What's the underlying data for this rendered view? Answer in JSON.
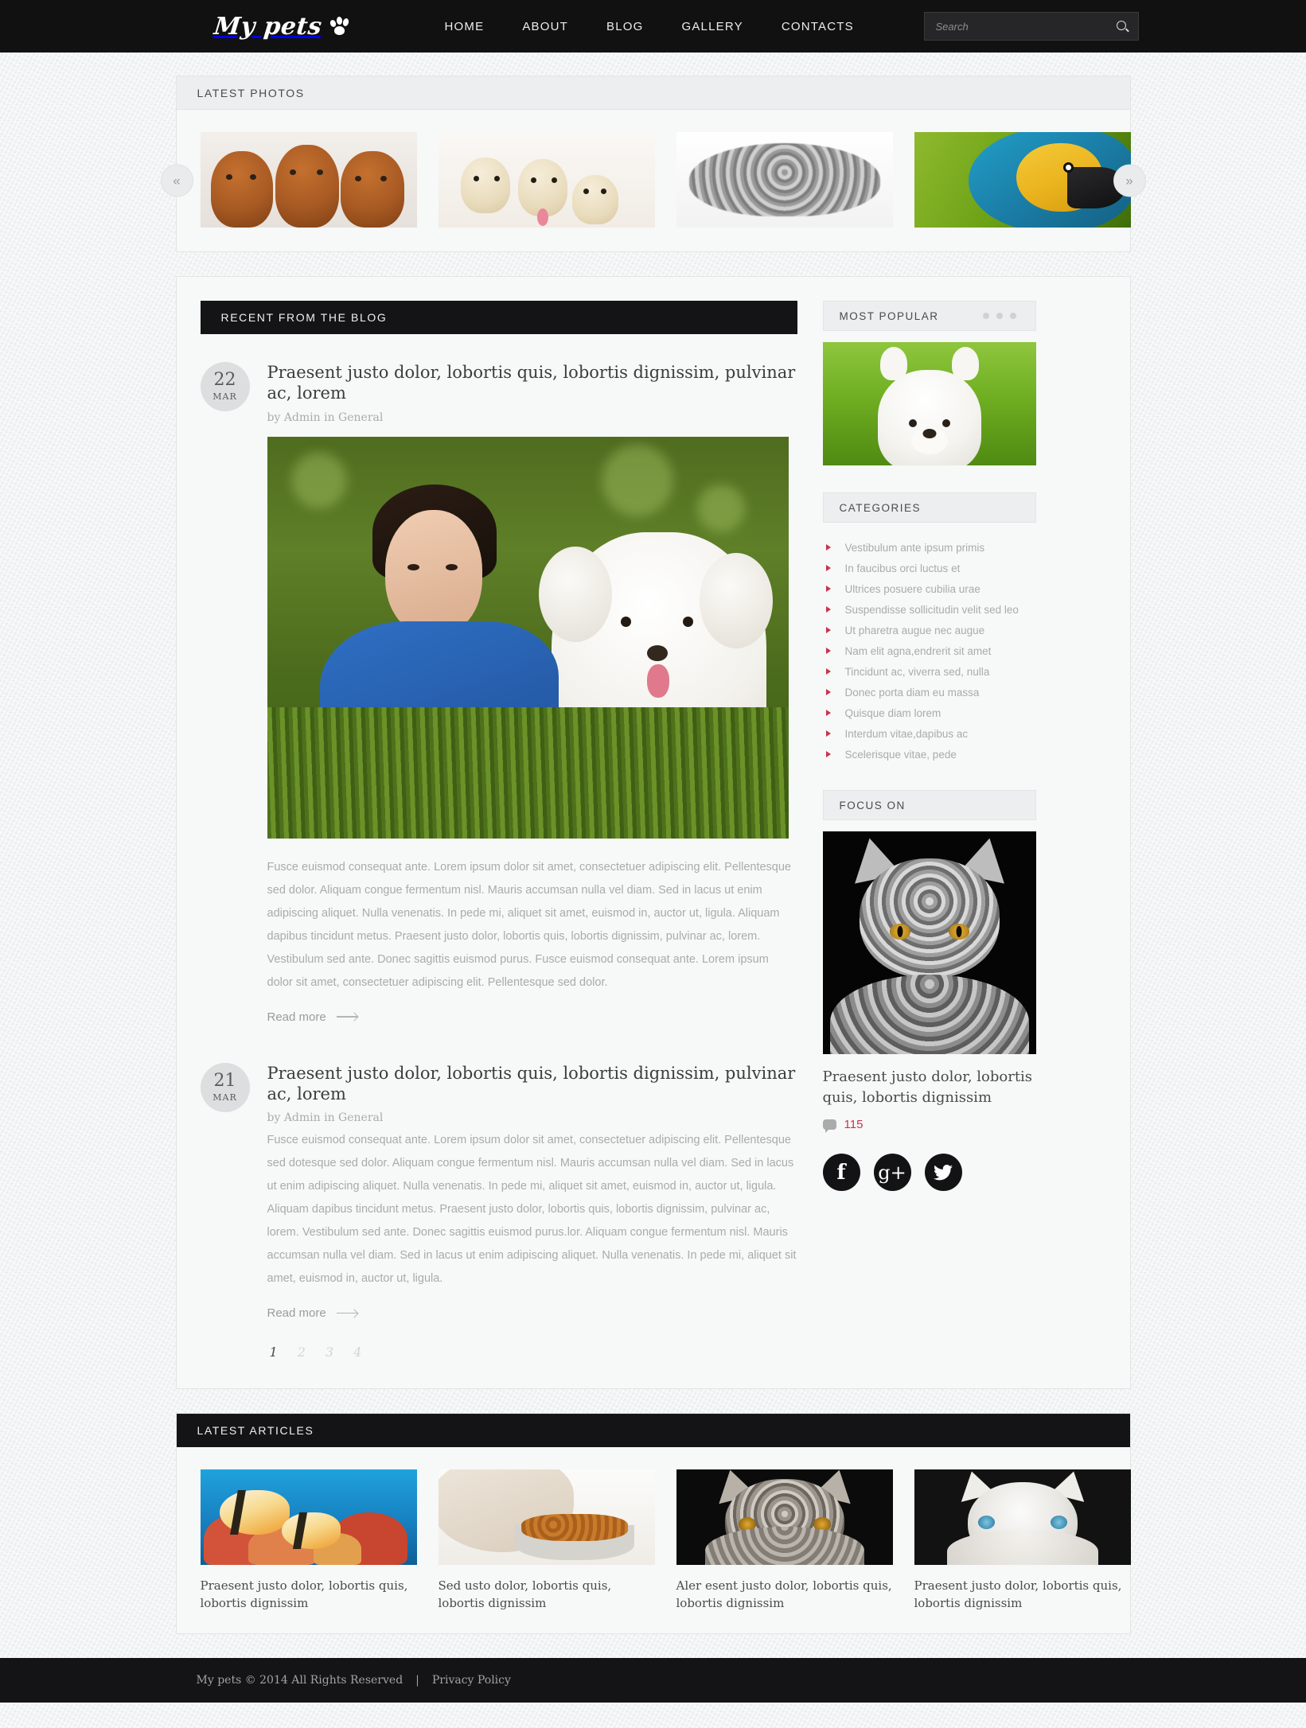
{
  "header": {
    "logo_text": "My pets",
    "logo_icon": "paw-icon",
    "nav": [
      {
        "label": "HOME"
      },
      {
        "label": "ABOUT"
      },
      {
        "label": "BLOG"
      },
      {
        "label": "GALLERY"
      },
      {
        "label": "CONTACTS"
      }
    ],
    "search": {
      "placeholder": "Search",
      "value": "",
      "icon": "search-icon"
    }
  },
  "latest_photos": {
    "title": "LATEST PHOTOS",
    "prev_label": "«",
    "next_label": "»",
    "items": [
      {
        "alt": "Three brown puppies"
      },
      {
        "alt": "Three cream labrador puppies"
      },
      {
        "alt": "Sleeping grey fluffy cat"
      },
      {
        "alt": "Blue and gold macaw parrot"
      }
    ]
  },
  "blog": {
    "title": "RECENT FROM THE BLOG",
    "posts": [
      {
        "day": "22",
        "month": "MAR",
        "title": "Praesent justo dolor, lobortis quis, lobortis dignissim, pulvinar ac, lorem",
        "meta": "by Admin in General",
        "image_alt": "Woman lying on grass with white poodle",
        "text": "Fusce euismod consequat ante. Lorem ipsum dolor sit amet, consectetuer adipiscing elit. Pellentesque sed dolor. Aliquam congue fermentum nisl. Mauris accumsan nulla vel diam. Sed in lacus ut enim adipiscing aliquet. Nulla venenatis. In pede mi, aliquet sit amet, euismod in, auctor ut, ligula. Aliquam dapibus tincidunt metus. Praesent justo dolor, lobortis quis, lobortis dignissim, pulvinar ac, lorem. Vestibulum sed ante. Donec sagittis euismod purus. Fusce euismod consequat ante. Lorem ipsum dolor sit amet, consectetuer adipiscing elit. Pellentesque sed dolor.",
        "read_more": "Read more"
      },
      {
        "day": "21",
        "month": "MAR",
        "title": "Praesent justo dolor, lobortis quis, lobortis dignissim, pulvinar ac, lorem",
        "meta": "by Admin in General",
        "text": "Fusce euismod consequat ante. Lorem ipsum dolor sit amet, consectetuer adipiscing elit. Pellentesque sed dotesque sed dolor. Aliquam congue fermentum nisl. Mauris accumsan nulla vel diam. Sed in lacus ut enim adipiscing aliquet. Nulla venenatis. In pede mi, aliquet sit amet, euismod in, auctor ut, ligula. Aliquam dapibus tincidunt metus. Praesent justo dolor, lobortis quis, lobortis dignissim, pulvinar ac, lorem. Vestibulum sed ante. Donec sagittis euismod purus.lor. Aliquam congue fermentum nisl. Mauris accumsan nulla vel diam. Sed in lacus ut enim adipiscing aliquet. Nulla venenatis. In pede mi, aliquet sit amet, euismod in, auctor ut, ligula.",
        "read_more": "Read more"
      }
    ],
    "pagination": [
      {
        "label": "1",
        "active": true
      },
      {
        "label": "2",
        "active": false
      },
      {
        "label": "3",
        "active": false
      },
      {
        "label": "4",
        "active": false
      }
    ]
  },
  "sidebar": {
    "most_popular": {
      "title": "MOST POPULAR",
      "dots": 3,
      "image_alt": "White terrier puppy on grass"
    },
    "categories": {
      "title": "CATEGORIES",
      "bullet_color": "#c9344b",
      "items": [
        "Vestibulum ante ipsum primis",
        "In faucibus orci luctus et",
        "Ultrices posuere cubilia urae",
        "Suspendisse sollicitudin velit sed leo",
        "Ut pharetra augue nec augue",
        "Nam elit agna,endrerit sit amet",
        "Tincidunt ac, viverra sed, nulla",
        "Donec porta diam eu massa",
        "Quisque diam lorem",
        "Interdum vitae,dapibus ac",
        "Scelerisque vitae, pede"
      ]
    },
    "focus_on": {
      "title": "FOCUS ON",
      "image_alt": "Silver tabby cat on black background",
      "caption": "Praesent justo dolor, lobortis quis, lobortis dignissim",
      "comment_count": "115",
      "comment_icon": "comment-bubble-icon"
    },
    "socials": [
      {
        "name": "facebook-icon",
        "glyph": "f"
      },
      {
        "name": "google-plus-icon",
        "glyph": "g+"
      },
      {
        "name": "twitter-icon",
        "glyph": "bird"
      }
    ]
  },
  "latest_articles": {
    "title": "LATEST ARTICLES",
    "items": [
      {
        "caption": "Praesent justo dolor, lobortis quis, lobortis dignissim",
        "alt": "Tropical fish on coral reef"
      },
      {
        "caption": "Sed usto dolor, lobortis quis, lobortis dignissim",
        "alt": "Cat eating from a bowl"
      },
      {
        "caption": "Aler esent justo dolor, lobortis quis, lobortis dignissim",
        "alt": "Long haired grey cat"
      },
      {
        "caption": "Praesent justo dolor, lobortis quis, lobortis dignissim",
        "alt": "White cat with blue eyes"
      }
    ]
  },
  "footer": {
    "copyright": "My pets © 2014 All Rights Reserved",
    "separator": "|",
    "privacy": "Privacy Policy"
  }
}
